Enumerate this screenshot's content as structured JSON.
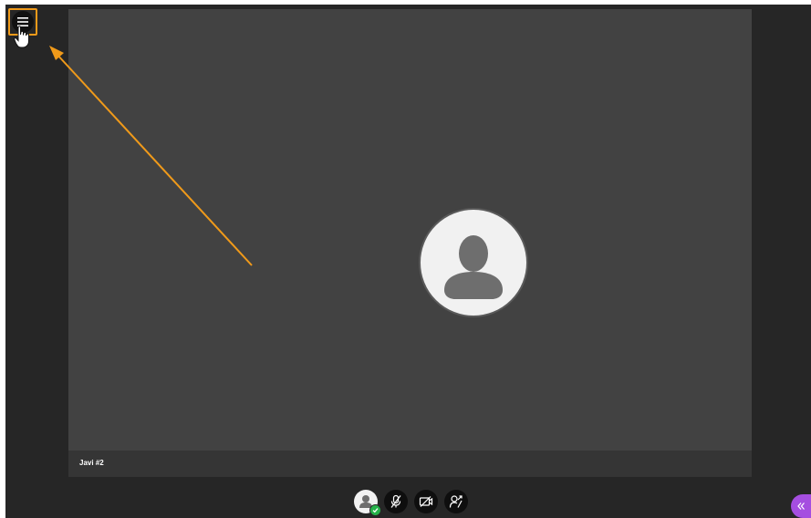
{
  "participant": {
    "name": "Javi #2"
  },
  "controls": {
    "menu_icon": "hamburger-menu-icon",
    "avatar_icon": "user-avatar-icon",
    "status_icon": "check-icon",
    "mic_icon": "microphone-muted-icon",
    "camera_icon": "camera-off-icon",
    "share_icon": "share-icon",
    "side_toggle_icon": "double-chevron-left-icon"
  },
  "colors": {
    "annotation": "#f09a1a",
    "status_ok": "#26b24a",
    "side_toggle": "#a54ee0",
    "video_bg": "#424242",
    "app_bg": "#262626"
  }
}
